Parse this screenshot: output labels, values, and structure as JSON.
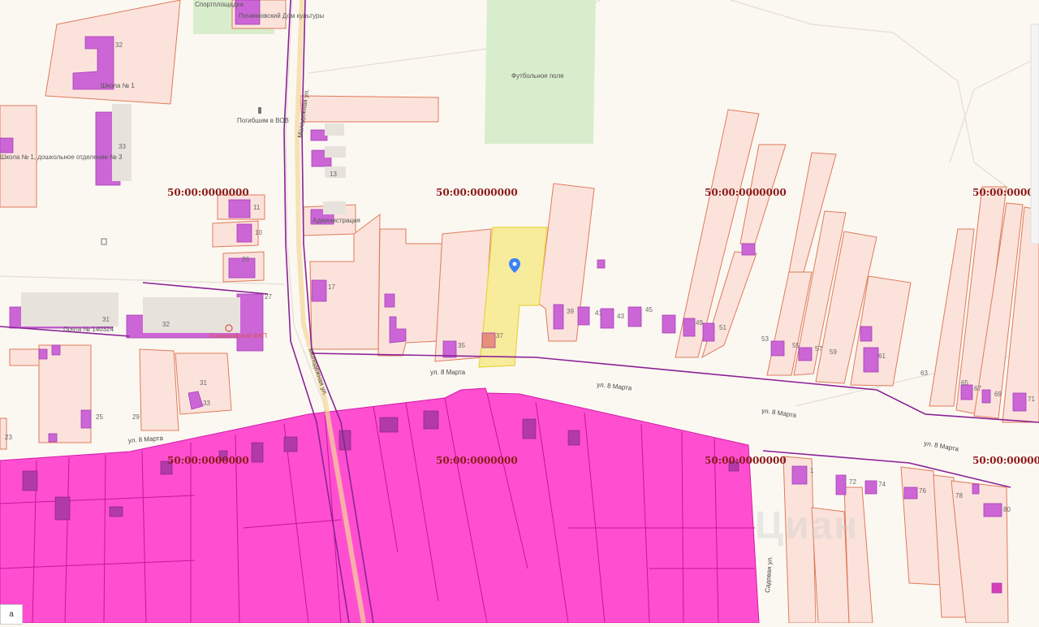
{
  "cadastral_label": "50:00:0000000",
  "streets": {
    "molodezhnaya": "Молодежная ул.",
    "march8": "ул. 8 Марта",
    "sadovaya": "Садовая ул."
  },
  "pois": {
    "sport": "Спортплощадка",
    "culture_house": "Починковский Дом культуры",
    "football": "Футбольное поле",
    "memorial": "Погибшим в ВОВ",
    "school": "Школа № 1",
    "school_left": "Школа № 1, дошкольное отделение № 3",
    "admin": "Администрация",
    "post": "Почта № 140324",
    "fap": "Починковский ФАП"
  },
  "house_numbers": [
    "32",
    "33",
    "13",
    "11",
    "10",
    "26",
    "17",
    "27",
    "31",
    "32",
    "25",
    "29",
    "31",
    "33",
    "23",
    "35",
    "37",
    "39",
    "41",
    "43",
    "45",
    "47",
    "49",
    "51",
    "53",
    "55",
    "57",
    "59",
    "61",
    "63",
    "65",
    "67",
    "69",
    "71",
    "72",
    "74",
    "76",
    "78",
    "80",
    "1"
  ],
  "corner_text": "a",
  "watermark": "Циан",
  "colors": {
    "background": "#fbf8f2",
    "parcel_fill": "#fbe3dc",
    "parcel_stroke": "#e07a5a",
    "building": "#cc66d6",
    "selected": "#f7ec9c",
    "magenta_zone": "#ff4fd0",
    "green": "#d8edcc",
    "cad_label": "#8b1a1a",
    "boundary": "#8b2296"
  }
}
